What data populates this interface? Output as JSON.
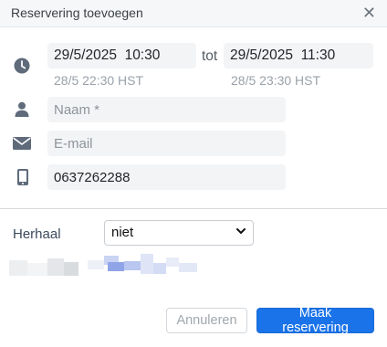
{
  "dialog": {
    "title": "Reservering toevoegen",
    "close_glyph": "✕"
  },
  "datetime": {
    "start_value": "29/5/2025  10:30",
    "start_tz": "28/5 22:30 HST",
    "separator": "tot",
    "end_value": "29/5/2025  11:30",
    "end_tz": "28/5 23:30 HST"
  },
  "form": {
    "name_placeholder": "Naam *",
    "email_placeholder": "E-mail",
    "phone_value": "0637262288"
  },
  "repeat": {
    "label": "Herhaal",
    "selected": "niet"
  },
  "buttons": {
    "cancel": "Annuleren",
    "submit": "Maak reservering"
  },
  "colors": {
    "primary": "#1a73e8",
    "icon": "#5f6b7a"
  },
  "icons": [
    "clock-icon",
    "person-icon",
    "envelope-icon",
    "phone-icon",
    "chevron-down-icon",
    "close-icon"
  ]
}
